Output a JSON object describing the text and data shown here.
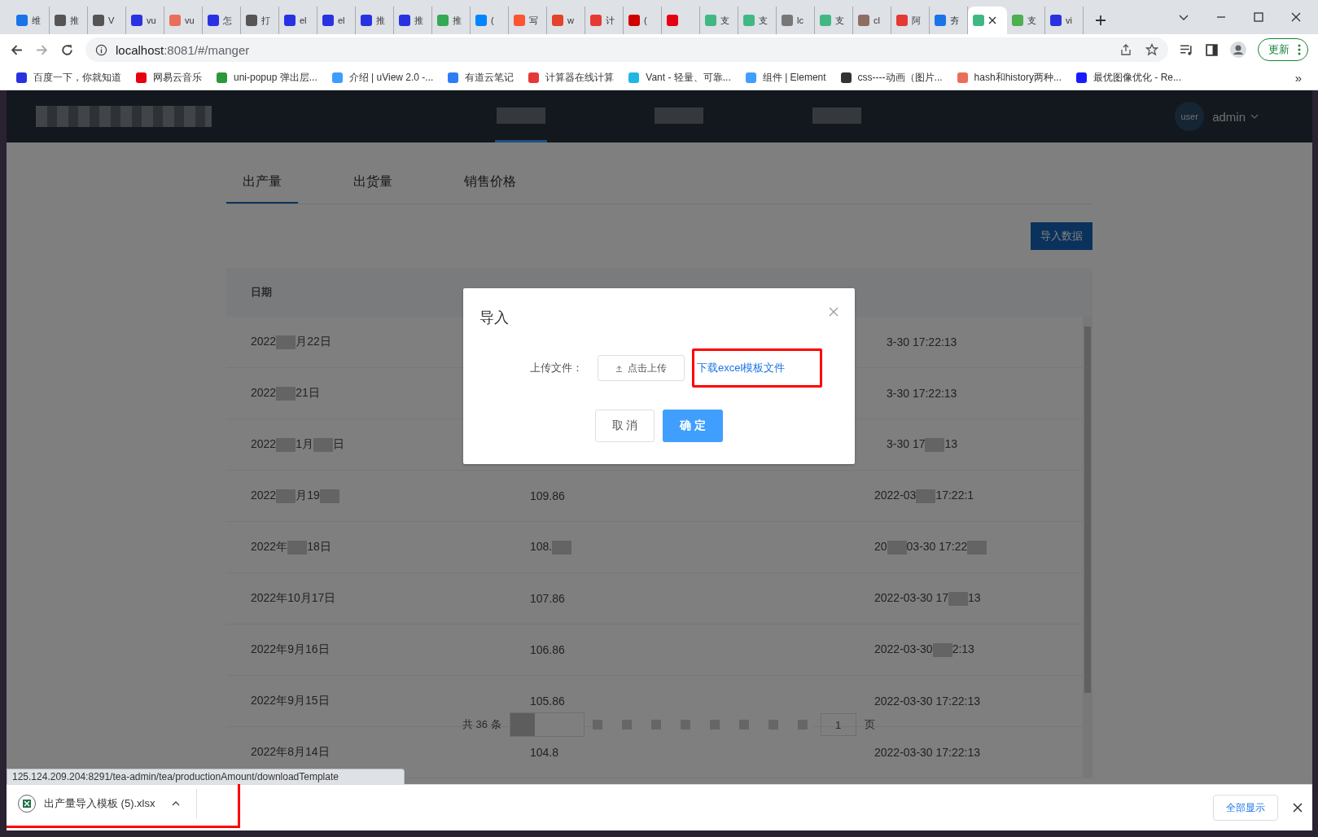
{
  "browser": {
    "tabs": [
      {
        "title": "维",
        "color": "#1a73e8",
        "selected": false
      },
      {
        "title": "推",
        "color": "#555555",
        "selected": false
      },
      {
        "title": "V",
        "color": "#555555",
        "selected": false
      },
      {
        "title": "vu",
        "color": "#2932e1",
        "selected": false
      },
      {
        "title": "vu",
        "color": "#ea6f5a",
        "selected": false
      },
      {
        "title": "怎",
        "color": "#2932e1",
        "selected": false
      },
      {
        "title": "打",
        "color": "#555555",
        "selected": false
      },
      {
        "title": "el",
        "color": "#2932e1",
        "selected": false
      },
      {
        "title": "el",
        "color": "#2932e1",
        "selected": false
      },
      {
        "title": "推",
        "color": "#2932e1",
        "selected": false
      },
      {
        "title": "推",
        "color": "#2932e1",
        "selected": false
      },
      {
        "title": "推",
        "color": "#34a853",
        "selected": false
      },
      {
        "title": "(",
        "color": "#0084ff",
        "selected": false
      },
      {
        "title": "写",
        "color": "#fc5531",
        "selected": false
      },
      {
        "title": "w",
        "color": "#e24329",
        "selected": false
      },
      {
        "title": "计",
        "color": "#e53935",
        "selected": false
      },
      {
        "title": "(",
        "color": "#d00000",
        "selected": false
      },
      {
        "color": "#e60012",
        "selected": false
      },
      {
        "title": "支",
        "color": "#41b883",
        "selected": false
      },
      {
        "title": "支",
        "color": "#41b883",
        "selected": false
      },
      {
        "title": "lc",
        "color": "#777777",
        "selected": false
      },
      {
        "title": "支",
        "color": "#41b883",
        "selected": false
      },
      {
        "title": "cl",
        "color": "#8d6e63",
        "selected": false
      },
      {
        "title": "阿",
        "color": "#e53935",
        "selected": false
      },
      {
        "title": "夯",
        "color": "#1a73e8",
        "selected": false
      },
      {
        "color": "#41b883",
        "selected": true
      },
      {
        "title": "支",
        "color": "#4caf50",
        "selected": false
      },
      {
        "title": "vi",
        "color": "#2932e1",
        "selected": false
      }
    ],
    "url_host": "localhost",
    "url_rest": ":8081/#/manger",
    "update_label": "更新",
    "bookmarks": [
      {
        "title": "百度一下，你就知道",
        "color": "#2932e1"
      },
      {
        "title": "网易云音乐",
        "color": "#e60012"
      },
      {
        "title": "uni-popup 弹出层...",
        "color": "#2b9939"
      },
      {
        "title": "介绍 | uView 2.0 -...",
        "color": "#3c9cff"
      },
      {
        "title": "有道云笔记",
        "color": "#2d7cf6"
      },
      {
        "title": "计算器在线计算",
        "color": "#e53935"
      },
      {
        "title": "Vant - 轻量、可靠...",
        "color": "#1fb7e3"
      },
      {
        "title": "组件 | Element",
        "color": "#409eff"
      },
      {
        "title": "css----动画（图片...",
        "color": "#333333"
      },
      {
        "title": "hash和history两种...",
        "color": "#ea6f5a"
      },
      {
        "title": "最优图像优化 - Re...",
        "color": "#1a1aff"
      }
    ],
    "more_label": "»"
  },
  "header": {
    "user_avatar": "user",
    "user_name": "admin",
    "nav": [
      {
        "selected": true
      },
      {
        "selected": false
      },
      {
        "selected": false
      }
    ]
  },
  "page_tabs": [
    {
      "label": "出产量",
      "selected": true
    },
    {
      "label": "出货量",
      "selected": false
    },
    {
      "label": "销售价格",
      "selected": false
    }
  ],
  "import_button": "导入数据",
  "table": {
    "columns": [
      "日期"
    ],
    "rows": [
      {
        "cells": [
          [
            {
              "text": "2022"
            },
            {
              "kind": "blur"
            },
            {
              "text": "月22日"
            }
          ],
          [],
          [
            {
              "text": "3-30 17:22:13"
            }
          ]
        ]
      },
      {
        "cells": [
          [
            {
              "text": "2022"
            },
            {
              "kind": "blur"
            },
            {
              "text": "21日"
            }
          ],
          [],
          [
            {
              "text": "3-30 17:22:13"
            }
          ]
        ]
      },
      {
        "cells": [
          [
            {
              "text": "2022"
            },
            {
              "kind": "blur"
            },
            {
              "text": "1月"
            },
            {
              "kind": "blur"
            },
            {
              "text": "日"
            }
          ],
          [],
          [
            {
              "text": "3-30 17"
            },
            {
              "kind": "blur"
            },
            {
              "text": "13"
            }
          ]
        ]
      },
      {
        "cells": [
          [
            {
              "text": "2022"
            },
            {
              "kind": "blur"
            },
            {
              "text": "月19"
            },
            {
              "kind": "blur"
            }
          ],
          [
            {
              "text": "109.86"
            }
          ],
          [
            {
              "text": "2022-03"
            },
            {
              "kind": "blur"
            },
            {
              "text": "17:22:1"
            }
          ]
        ]
      },
      {
        "cells": [
          [
            {
              "text": "2022年"
            },
            {
              "kind": "blur"
            },
            {
              "text": "18日"
            }
          ],
          [
            {
              "text": "108."
            },
            {
              "kind": "blur"
            }
          ],
          [
            {
              "text": "20"
            },
            {
              "kind": "blur"
            },
            {
              "text": "03-30 17:22"
            },
            {
              "kind": "blur"
            }
          ]
        ]
      },
      {
        "cells": [
          [
            {
              "text": "2022年10月17日"
            }
          ],
          [
            {
              "text": "107.86"
            }
          ],
          [
            {
              "text": "2022-03-30 17"
            },
            {
              "kind": "blur"
            },
            {
              "text": "13"
            }
          ]
        ]
      },
      {
        "cells": [
          [
            {
              "text": "2022年9月16日"
            }
          ],
          [
            {
              "text": "106.86"
            }
          ],
          [
            {
              "text": "2022-03-30"
            },
            {
              "kind": "blur"
            },
            {
              "text": "2:13"
            }
          ]
        ]
      },
      {
        "cells": [
          [
            {
              "text": "2022年9月15日"
            }
          ],
          [
            {
              "text": "105.86"
            }
          ],
          [
            {
              "text": "2022-03-30 17:22:13"
            }
          ]
        ]
      },
      {
        "cells": [
          [
            {
              "text": "2022年8月14日"
            }
          ],
          [
            {
              "text": "104.8"
            }
          ],
          [
            {
              "text": "2022-03-30 17:22:13"
            }
          ]
        ]
      }
    ]
  },
  "pagination": {
    "total": "共 36 条",
    "page": "1",
    "page_suffix": "页"
  },
  "dialog": {
    "title": "导入",
    "field_label": "上传文件：",
    "upload_button": "点击上传",
    "template_link": "下载excel模板文件",
    "cancel": "取 消",
    "confirm": "确 定"
  },
  "status_url": "125.124.209.204:8291/tea-admin/tea/productionAmount/downloadTemplate",
  "downloads": {
    "file": "出产量导入模板 (5).xlsx",
    "show_all": "全部显示"
  }
}
